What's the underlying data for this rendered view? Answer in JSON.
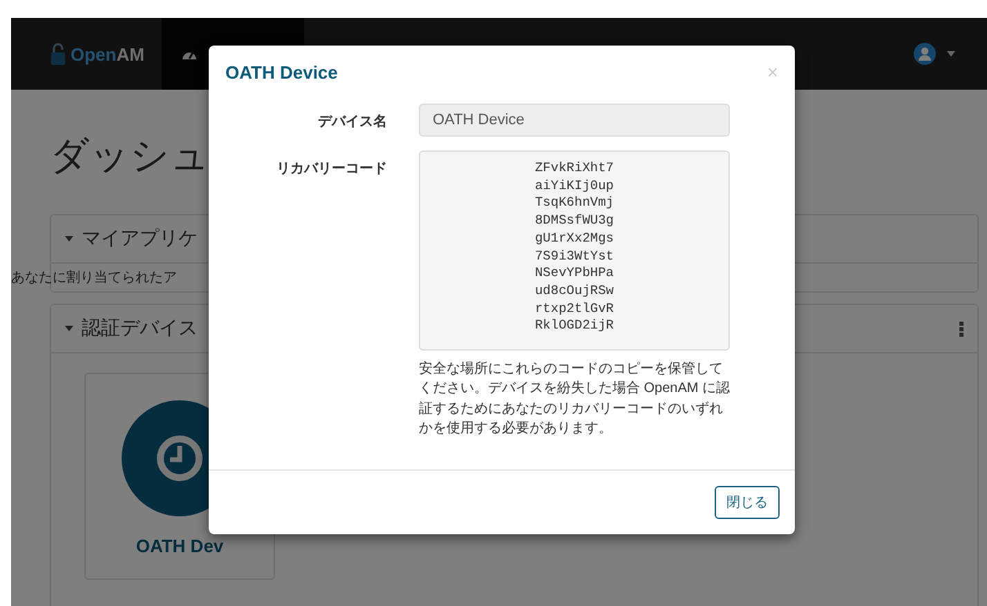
{
  "navbar": {
    "brand": {
      "prefix": "Open",
      "suffix": "AM"
    }
  },
  "page": {
    "title": "ダッシュ",
    "panels": [
      {
        "heading": "マイアプリケ",
        "expanded": true,
        "body": "あなたに割り当てられたア"
      },
      {
        "heading": "認証デバイス",
        "expanded": true,
        "devices": [
          {
            "name": "OATH Dev"
          }
        ]
      }
    ]
  },
  "modal": {
    "title": "OATH Device",
    "close": "×",
    "fields": [
      {
        "kind": "input",
        "label": "デバイス名",
        "value": "OATH Device"
      },
      {
        "kind": "codes",
        "label": "リカバリーコード",
        "codes": [
          "ZFvkRiXht7",
          "aiYiKIj0up",
          "TsqK6hnVmj",
          "8DMSsfWU3g",
          "gU1rXx2Mgs",
          "7S9i3WtYst",
          "NSevYPbHPa",
          "ud8cOujRSw",
          "rtxp2tlGvR",
          "RklOGD2ijR"
        ]
      }
    ],
    "help": "安全な場所にこれらのコードのコピーを保管してください。デバイスを紛失した場合 OpenAM に認証するためにあなたのリカバリーコードのいずれかを使用する必要があります。",
    "button": "閉じる"
  }
}
